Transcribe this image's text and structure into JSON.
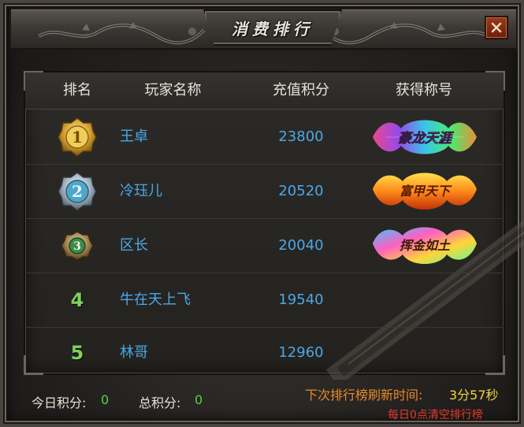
{
  "window": {
    "title": "消费排行",
    "close_icon": "close-icon"
  },
  "table": {
    "headers": {
      "rank": "排名",
      "name": "玩家名称",
      "score": "充值积分",
      "title": "获得称号"
    },
    "rows": [
      {
        "rank": "1",
        "rank_style": "gold-medal",
        "name": "王卓",
        "score": "23800",
        "badge_text": "豪龙天涯",
        "badge_style": "rainbow"
      },
      {
        "rank": "2",
        "rank_style": "silver-medal",
        "name": "冷珏儿",
        "score": "20520",
        "badge_text": "富甲天下",
        "badge_style": "fire"
      },
      {
        "rank": "3",
        "rank_style": "bronze-medal",
        "name": "区长",
        "score": "20040",
        "badge_text": "挥金如土",
        "badge_style": "rainbow-gold"
      },
      {
        "rank": "4",
        "rank_style": "plain",
        "name": "牛在天上飞",
        "score": "19540"
      },
      {
        "rank": "5",
        "rank_style": "plain",
        "name": "林哥",
        "score": "12960"
      }
    ]
  },
  "footer": {
    "today_label": "今日积分:",
    "today_value": "0",
    "total_label": "总积分:",
    "total_value": "0",
    "refresh_label": "下次排行榜刷新时间:",
    "refresh_value": "3分57秒",
    "clear_notice": "每日0点清空排行榜"
  },
  "colors": {
    "name_blue": "#4aa8e8",
    "rank_green": "#7ed25a",
    "refresh_orange": "#e98a2c",
    "refresh_yellow": "#f2d23a",
    "clear_red": "#e03b2a",
    "value_green": "#58d048"
  }
}
